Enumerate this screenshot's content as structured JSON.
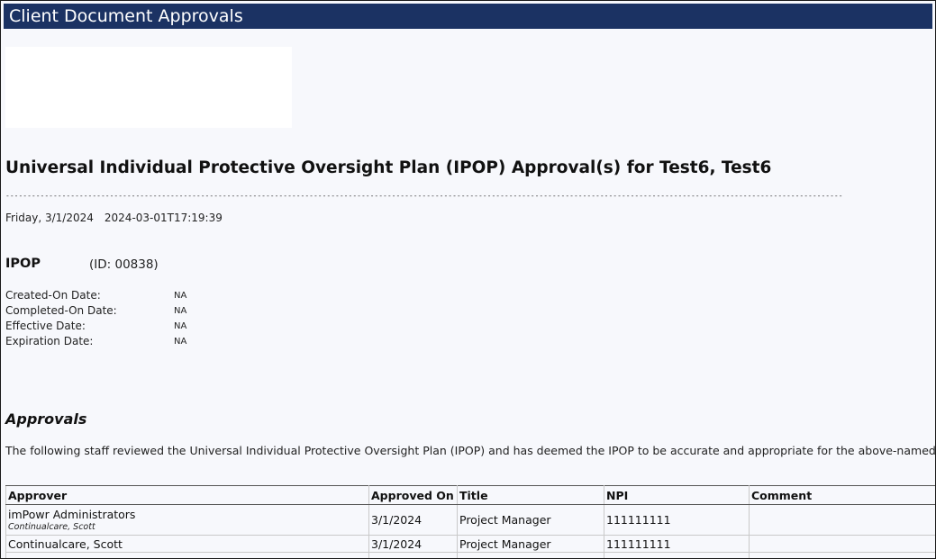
{
  "window": {
    "title": "Client Document Approvals"
  },
  "document": {
    "heading": "Universal Individual Protective Oversight Plan (IPOP) Approval(s) for Test6, Test6",
    "date_text": "Friday, 3/1/2024",
    "timestamp": "2024-03-01T17:19:39",
    "plan_type": "IPOP",
    "plan_id": "(ID: 00838)",
    "details": [
      {
        "label": "Created-On Date:",
        "value": "NA"
      },
      {
        "label": "Completed-On Date:",
        "value": "NA"
      },
      {
        "label": "Effective Date:",
        "value": "NA"
      },
      {
        "label": "Expiration Date:",
        "value": "NA"
      }
    ]
  },
  "approvals": {
    "heading": "Approvals",
    "description": "The following staff reviewed the Universal Individual Protective Oversight Plan (IPOP) and has deemed the IPOP to be accurate and appropriate for the above-named client.",
    "columns": [
      "Approver",
      "Approved On",
      "Title",
      "NPI",
      "Comment"
    ],
    "rows": [
      {
        "approver": "imPowr Administrators",
        "approver_sub": "Continualcare, Scott",
        "approved_on": "3/1/2024",
        "title": "Project Manager",
        "npi": "111111111",
        "comment": ""
      },
      {
        "approver": "Continualcare, Scott",
        "approver_sub": "",
        "approved_on": "3/1/2024",
        "title": "Project Manager",
        "npi": "111111111",
        "comment": ""
      }
    ]
  }
}
